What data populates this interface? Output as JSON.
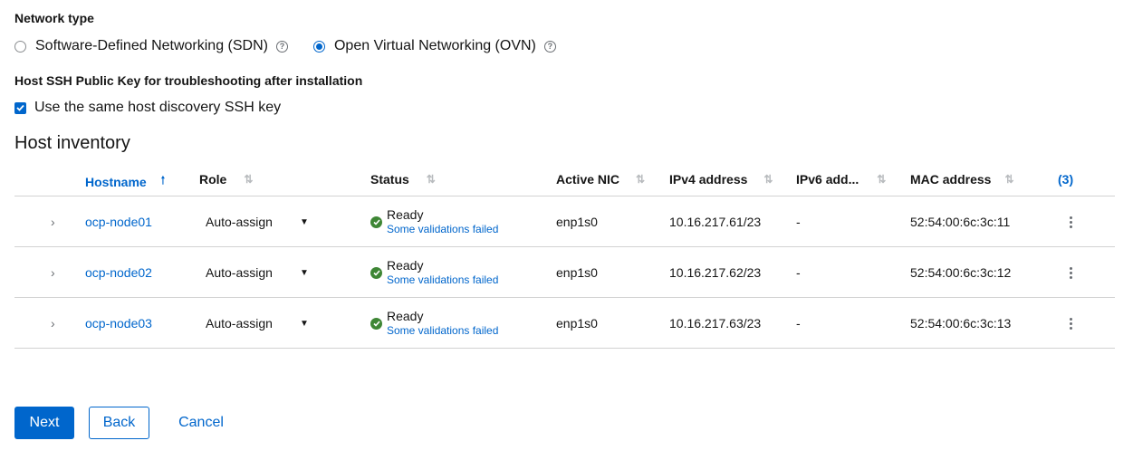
{
  "network_type": {
    "label": "Network type",
    "options": [
      {
        "label": "Software-Defined Networking (SDN)",
        "selected": false
      },
      {
        "label": "Open Virtual Networking (OVN)",
        "selected": true
      }
    ]
  },
  "ssh_key": {
    "label": "Host SSH Public Key for troubleshooting after installation",
    "checkbox_label": "Use the same host discovery SSH key",
    "checked": true
  },
  "inventory": {
    "title": "Host inventory",
    "columns": {
      "hostname": "Hostname",
      "role": "Role",
      "status": "Status",
      "active_nic": "Active NIC",
      "ipv4": "IPv4 address",
      "ipv6": "IPv6 add...",
      "mac": "MAC address",
      "count": "(3)"
    },
    "rows": [
      {
        "hostname": "ocp-node01",
        "role": "Auto-assign",
        "status": "Ready",
        "status_detail": "Some validations failed",
        "nic": "enp1s0",
        "ipv4": "10.16.217.61/23",
        "ipv6": "-",
        "mac": "52:54:00:6c:3c:11"
      },
      {
        "hostname": "ocp-node02",
        "role": "Auto-assign",
        "status": "Ready",
        "status_detail": "Some validations failed",
        "nic": "enp1s0",
        "ipv4": "10.16.217.62/23",
        "ipv6": "-",
        "mac": "52:54:00:6c:3c:12"
      },
      {
        "hostname": "ocp-node03",
        "role": "Auto-assign",
        "status": "Ready",
        "status_detail": "Some validations failed",
        "nic": "enp1s0",
        "ipv4": "10.16.217.63/23",
        "ipv6": "-",
        "mac": "52:54:00:6c:3c:13"
      }
    ]
  },
  "actions": {
    "next": "Next",
    "back": "Back",
    "cancel": "Cancel"
  },
  "colors": {
    "primary": "#0066cc",
    "success": "#3e8635",
    "border": "#d2d2d2"
  }
}
